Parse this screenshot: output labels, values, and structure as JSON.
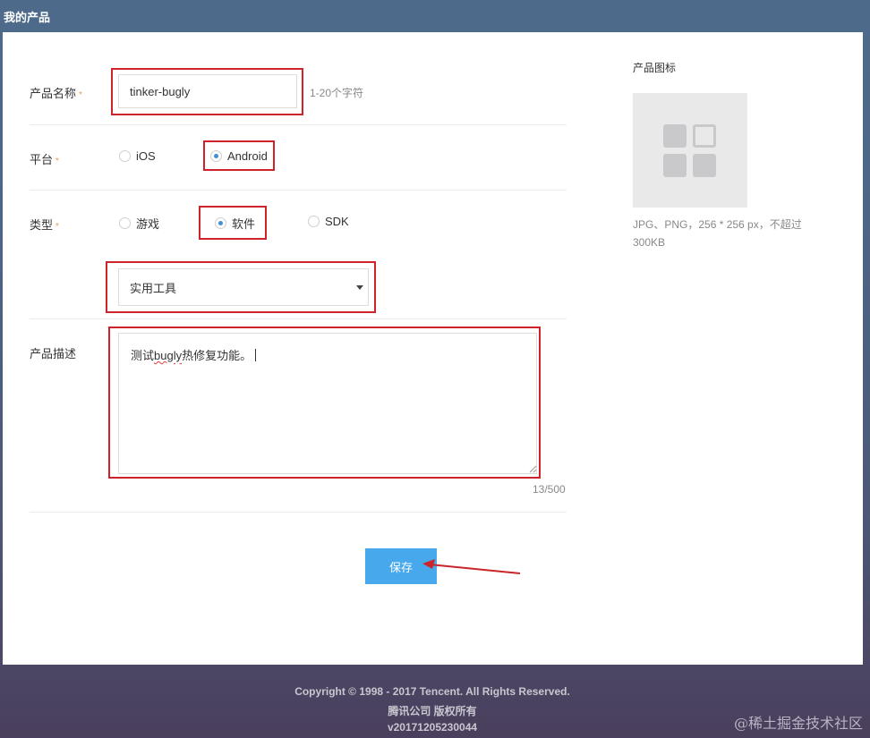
{
  "header": {
    "title": "我的产品"
  },
  "form": {
    "name": {
      "label": "产品名称",
      "required_mark": "*",
      "value": "tinker-bugly",
      "hint": "1-20个字符"
    },
    "platform": {
      "label": "平台",
      "required_mark": "*",
      "options": [
        "iOS",
        "Android"
      ],
      "selected": "Android"
    },
    "type": {
      "label": "类型",
      "required_mark": "*",
      "options": [
        "游戏",
        "软件",
        "SDK"
      ],
      "selected": "软件",
      "category_value": "实用工具"
    },
    "description": {
      "label": "产品描述",
      "text_prefix": "测试",
      "text_misspelled": "bugly",
      "text_suffix": "热修复功能。",
      "counter": "13/500"
    },
    "save_label": "保存"
  },
  "icon_panel": {
    "label": "产品图标",
    "hint_line1": "JPG、PNG，256 * 256 px，不超过",
    "hint_line2": "300KB"
  },
  "footer": {
    "copyright": "Copyright © 1998 - 2017 Tencent. All Rights Reserved.",
    "company": "腾讯公司 版权所有",
    "version": "v20171205230044"
  },
  "watermark": "@稀土掘金技术社区",
  "colors": {
    "accent": "#47a8ec",
    "highlight": "#d0222a",
    "header": "#4e6a8a"
  }
}
